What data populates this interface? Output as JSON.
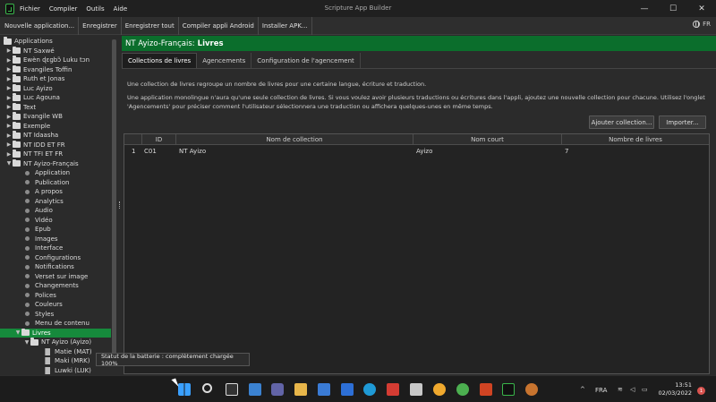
{
  "window": {
    "title": "Scripture App Builder",
    "menu": [
      "Fichier",
      "Compiler",
      "Outils",
      "Aide"
    ],
    "controls": [
      "—",
      "☐",
      "✕"
    ]
  },
  "toolbar": {
    "buttons": [
      "Nouvelle application...",
      "Enregistrer",
      "Enregistrer tout",
      "Compiler appli Android",
      "Installer APK..."
    ],
    "language": "FR"
  },
  "tree": {
    "root": "Applications",
    "apps": [
      "NT Saxwé",
      "Ewèn ɖɛgbɔ̃ Luku tɔn",
      "Evangiles Toffin",
      "Ruth et Jonas",
      "Luc Ayizo",
      "Luc Agouna",
      "Text",
      "Evangile WB",
      "Exemple",
      "NT Idaasha",
      "NT IDD ET FR",
      "NT TFI ET FR",
      "NT Ayizo-Français"
    ],
    "sections": [
      "Application",
      "Publication",
      "A propos",
      "Analytics",
      "Audio",
      "Vidéo",
      "Epub",
      "Images",
      "Interface",
      "Configurations",
      "Notifications",
      "Verset sur image",
      "Changements",
      "Polices",
      "Couleurs",
      "Styles",
      "Menu de contenu"
    ],
    "selected": "Livres",
    "collection": "NT Ayizo (Ayizo)",
    "books": [
      "Matie (MAT)",
      "Maki (MRK)",
      "Luwki (LUK)"
    ]
  },
  "main": {
    "header_prefix": "NT Ayizo-Français:",
    "header_title": "Livres",
    "tabs": [
      "Collections de livres",
      "Agencements",
      "Configuration de l'agencement"
    ],
    "description1": "Une collection de livres regroupe un nombre de livres pour une certaine langue, écriture et traduction.",
    "description2": "Une application monolingue n'aura qu'une seule collection de livres. Si vous voulez avoir plusieurs traductions ou écritures dans l'appli, ajoutez une nouvelle collection pour chacune. Utilisez l'onglet 'Agencements' pour préciser comment l'utilisateur sélectionnera une traduction ou affichera quelques-unes en même temps.",
    "add_button": "Ajouter collection...",
    "import_button": "Importer...",
    "table": {
      "columns": [
        "ID",
        "Nom de collection",
        "Nom court",
        "Nombre de livres"
      ],
      "rows": [
        {
          "num": "1",
          "id": "C01",
          "name": "NT Ayizo",
          "short": "Ayizo",
          "count": "7"
        }
      ]
    }
  },
  "tooltip": "Statut de la batterie : complètement chargée 100%",
  "taskbar": {
    "tray_chevron": "^",
    "lang": "FRA",
    "time": "13:51",
    "date": "02/03/2022",
    "notification_count": "1"
  },
  "colors": {
    "accent_green": "#0b6e2c",
    "selected_green": "#168a3c",
    "background": "#2b2b2b"
  }
}
